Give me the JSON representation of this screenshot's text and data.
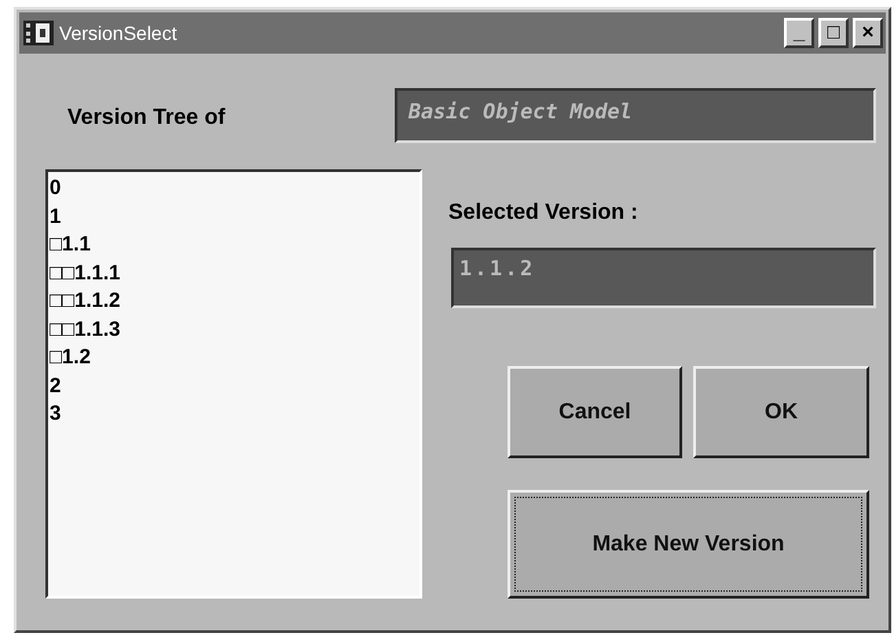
{
  "window": {
    "title": "VersionSelect",
    "controls": [
      "_",
      "□",
      "×"
    ]
  },
  "tree_label": "Version Tree of",
  "model_field": {
    "value": "Basic Object Model"
  },
  "version_list": {
    "items": [
      {
        "text": "0"
      },
      {
        "text": "1"
      },
      {
        "text": "□1.1"
      },
      {
        "text": "□□1.1.1"
      },
      {
        "text": "□□1.1.2"
      },
      {
        "text": "□□1.1.3"
      },
      {
        "text": "□1.2"
      },
      {
        "text": "2"
      },
      {
        "text": "3"
      }
    ]
  },
  "selected_label": "Selected Version :",
  "selected_field": {
    "value": "1.1.2"
  },
  "buttons": [
    {
      "label": "Cancel",
      "focused": false
    },
    {
      "label": "OK",
      "focused": false
    },
    {
      "label": "Make New Version",
      "focused": true
    }
  ]
}
